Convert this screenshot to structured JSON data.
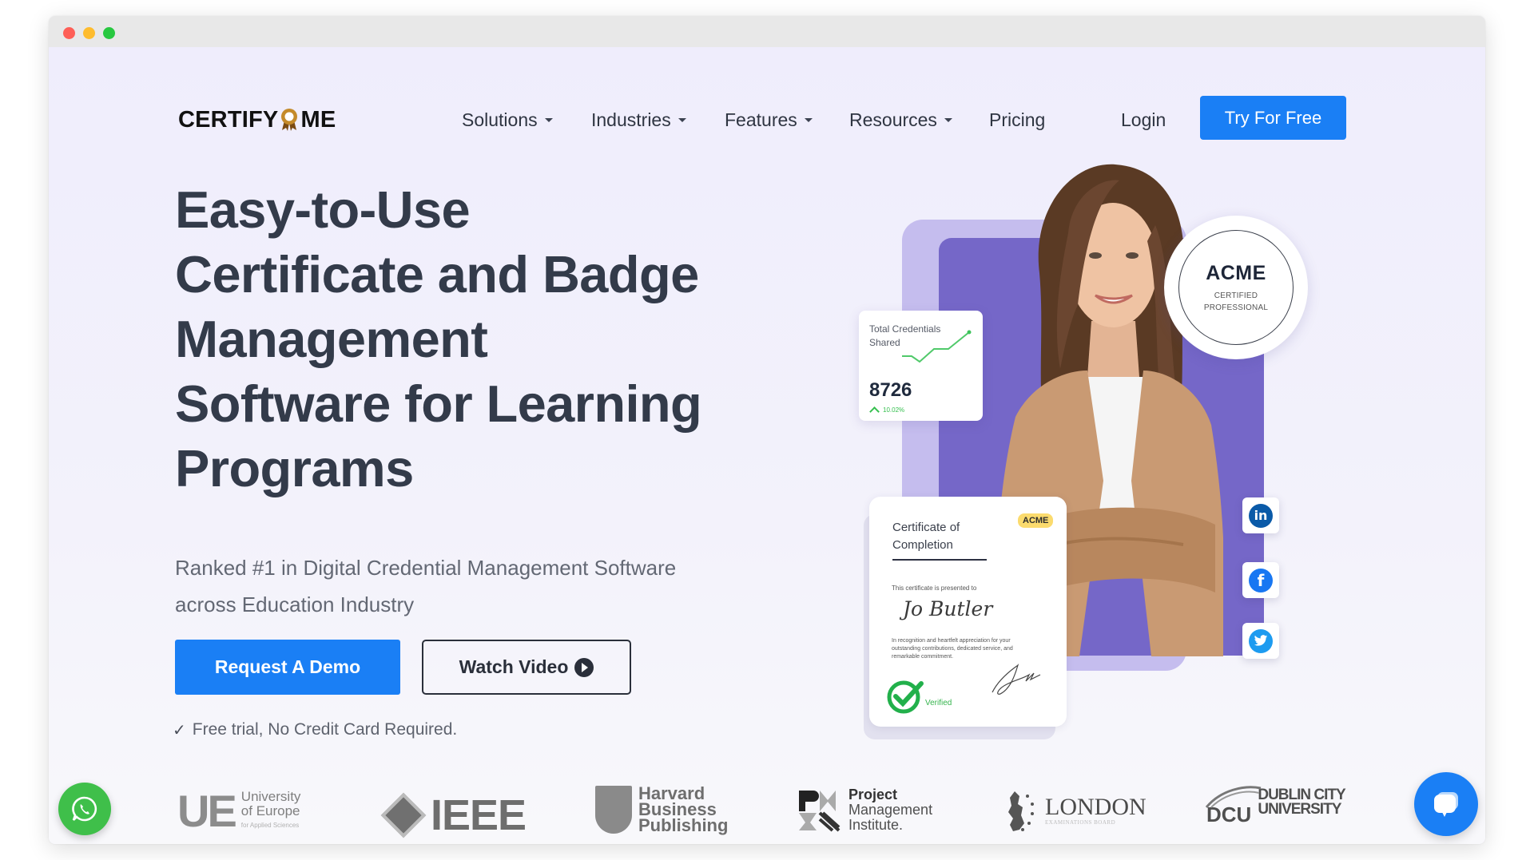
{
  "window": {
    "controls": [
      "close",
      "minimize",
      "maximize"
    ]
  },
  "header": {
    "logo_left": "CERTIFY",
    "logo_right": "ME",
    "logo_icon": "award-ribbon-icon",
    "nav": [
      {
        "label": "Solutions",
        "dropdown": true
      },
      {
        "label": "Industries",
        "dropdown": true
      },
      {
        "label": "Features",
        "dropdown": true
      },
      {
        "label": "Resources",
        "dropdown": true
      },
      {
        "label": "Pricing",
        "dropdown": false
      }
    ],
    "login_label": "Login",
    "cta_label": "Try For Free"
  },
  "hero": {
    "title_lines": [
      "Easy-to-Use",
      "Certificate and Badge",
      "Management",
      "Software for Learning",
      "Programs"
    ],
    "subtitle_lines": [
      "Ranked #1 in Digital Credential Management Software",
      "across Education Industry"
    ],
    "primary_button": "Request A Demo",
    "secondary_button": "Watch Video",
    "secondary_icon": "play-circle-icon",
    "note": "Free trial, No Credit Card Required.",
    "note_icon": "check-icon"
  },
  "illustration": {
    "stats_card": {
      "label": "Total Credentials Shared",
      "value": "8726",
      "change": "10.02%",
      "trend": "up"
    },
    "badge": {
      "title": "ACME",
      "subtitle_line1": "CERTIFIED",
      "subtitle_line2": "PROFESSIONAL"
    },
    "certificate": {
      "title_line1": "Certificate of",
      "title_line2": "Completion",
      "tag": "ACME",
      "presented_to": "This certificate is presented to",
      "recipient": "Jo Butler",
      "body": "In recognition and heartfelt appreciation for your outstanding contributions, dedicated service, and remarkable commitment.",
      "verified_label": "Verified"
    },
    "social": [
      {
        "name": "linkedin",
        "glyph": "in",
        "color": "#0a66c2"
      },
      {
        "name": "facebook",
        "glyph": "f",
        "color": "#1877f2"
      },
      {
        "name": "twitter",
        "glyph": "t",
        "color": "#1d9bf0"
      }
    ]
  },
  "logos": {
    "ue": {
      "mark": "UE",
      "line1": "University",
      "line2": "of Europe",
      "line3": "for Applied Sciences"
    },
    "ieee": {
      "text": "IEEE"
    },
    "hbp": {
      "line1": "Harvard",
      "line2": "Business",
      "line3": "Publishing"
    },
    "pmi": {
      "line1": "Project",
      "line2": "Management",
      "line3": "Institute."
    },
    "london": {
      "line1": "LONDON",
      "line2": "EXAMINATIONS BOARD"
    },
    "dcu": {
      "mark": "DCU",
      "line1": "DUBLIN CITY",
      "line2": "UNIVERSITY"
    }
  },
  "floating": {
    "whatsapp_icon": "whatsapp-icon",
    "chat_icon": "chat-bubble-icon"
  },
  "colors": {
    "primary": "#1a7ff5",
    "heading": "#333b4a",
    "panel_purple": "#7567c8",
    "panel_light": "#c5bdee",
    "success": "#36b44e",
    "whatsapp": "#3fbf4a"
  }
}
